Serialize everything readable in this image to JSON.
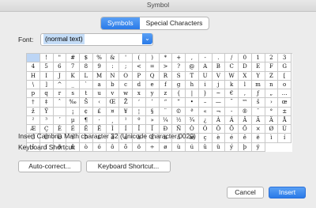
{
  "window": {
    "title": "Symbol"
  },
  "tabs": [
    {
      "label": "Symbols",
      "active": true
    },
    {
      "label": "Special Characters",
      "active": false
    }
  ],
  "font": {
    "label": "Font:",
    "value": "(normal text)"
  },
  "symbols": [
    " ",
    "!",
    "\"",
    "#",
    "$",
    "%",
    "&",
    "'",
    "(",
    ")",
    "*",
    "+",
    ",",
    "-",
    ".",
    "/",
    "0",
    "1",
    "2",
    "3",
    "4",
    "5",
    "6",
    "7",
    "8",
    "9",
    ":",
    ";",
    "<",
    "=",
    ">",
    "?",
    "@",
    "A",
    "B",
    "C",
    "D",
    "E",
    "F",
    "G",
    "H",
    "I",
    "J",
    "K",
    "L",
    "M",
    "N",
    "O",
    "P",
    "Q",
    "R",
    "S",
    "T",
    "U",
    "V",
    "W",
    "X",
    "Y",
    "Z",
    "[",
    "\\",
    "]",
    "^",
    "_",
    "`",
    "a",
    "b",
    "c",
    "d",
    "e",
    "f",
    "g",
    "h",
    "i",
    "j",
    "k",
    "l",
    "m",
    "n",
    "o",
    "p",
    "q",
    "r",
    "s",
    "t",
    "u",
    "v",
    "w",
    "x",
    "y",
    "z",
    "{",
    "|",
    "}",
    "~",
    "€",
    "‚",
    "ƒ",
    "„",
    "…",
    "†",
    "‡",
    "ˆ",
    "‰",
    "Š",
    "‹",
    "Œ",
    "Ž",
    "‘",
    "’",
    "“",
    "”",
    "•",
    "–",
    "—",
    "˜",
    "™",
    "š",
    "›",
    "œ",
    "ž",
    "Ÿ",
    " ",
    "¡",
    "¢",
    "£",
    "¤",
    "¥",
    "¦",
    "§",
    "¨",
    "©",
    "ª",
    "«",
    "¬",
    "-",
    "®",
    "¯",
    "°",
    "±",
    "²",
    "³",
    "´",
    "µ",
    "¶",
    "·",
    "¸",
    "¹",
    "º",
    "»",
    "¼",
    "½",
    "¾",
    "¿",
    "À",
    "Á",
    "Â",
    "Ã",
    "Ä",
    "Å",
    "Æ",
    "Ç",
    "È",
    "É",
    "Ê",
    "Ë",
    "Ì",
    "Í",
    "Î",
    "Ï",
    "Ð",
    "Ñ",
    "Ò",
    "Ó",
    "Ô",
    "Õ",
    "Ö",
    "×",
    "Ø",
    "Ù",
    "Ú",
    "Û",
    "Ü",
    "Ý",
    "Þ",
    "ß",
    "à",
    "á",
    "â",
    "ã",
    "ä",
    "å",
    "æ",
    "ç",
    "è",
    "é",
    "ê",
    "ë",
    "ì",
    "í",
    "î",
    "ï",
    "ð",
    "ñ",
    "ò",
    "ó",
    "ô",
    "õ",
    "ö",
    "÷",
    "ø",
    "ù",
    "ú",
    "û",
    "ü",
    "ý",
    "þ",
    "ÿ"
  ],
  "selected_index": 0,
  "character_info": "Insert Cambria Math character 32 (Unicode character 0020)",
  "keyboard_shortcut_label": "Keyboard Shortcut:",
  "buttons": {
    "autocorrect": "Auto-correct...",
    "keyboard_shortcut": "Keyboard Shortcut...",
    "cancel": "Cancel",
    "insert": "Insert"
  }
}
